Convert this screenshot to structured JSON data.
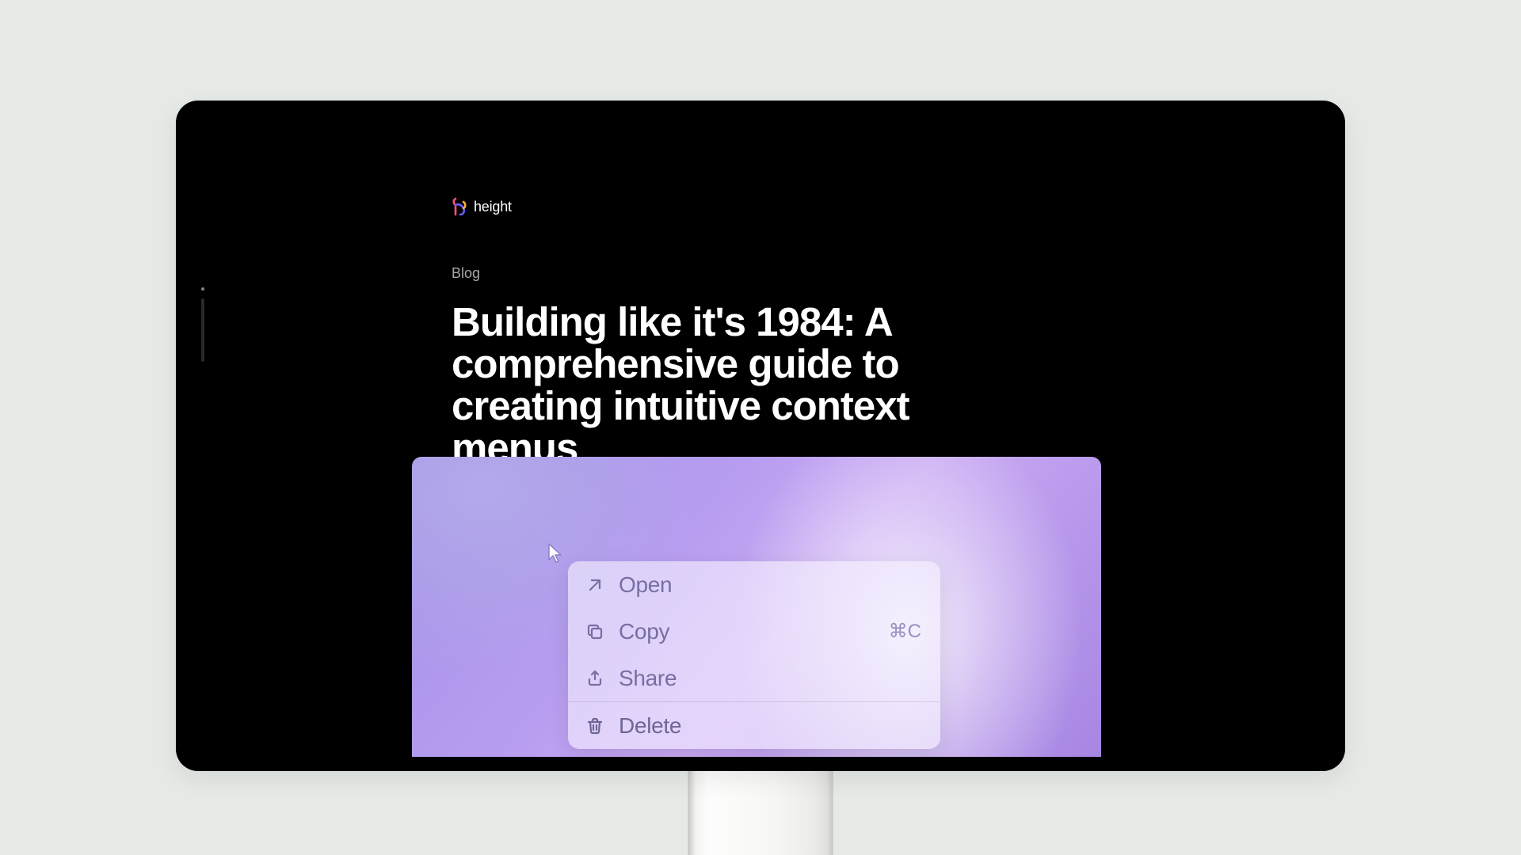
{
  "brand": {
    "name": "height"
  },
  "breadcrumb": "Blog",
  "title": "Building like it's 1984: A comprehensive guide to creating intuitive context menus",
  "context_menu": {
    "items": [
      {
        "icon": "arrow-up-right-icon",
        "label": "Open",
        "shortcut": ""
      },
      {
        "icon": "copy-icon",
        "label": "Copy",
        "shortcut": "⌘C"
      },
      {
        "icon": "share-icon",
        "label": "Share",
        "shortcut": ""
      }
    ],
    "destructive": {
      "icon": "trash-icon",
      "label": "Delete",
      "shortcut": ""
    }
  },
  "colors": {
    "page_bg": "#e6eae6",
    "monitor_bg": "#000000",
    "text_primary": "#ffffff",
    "text_muted": "#a8a8a8",
    "hero_purple": "#a585e2",
    "menu_text": "#776fa3",
    "shortcut_text": "#9b8fc0"
  }
}
